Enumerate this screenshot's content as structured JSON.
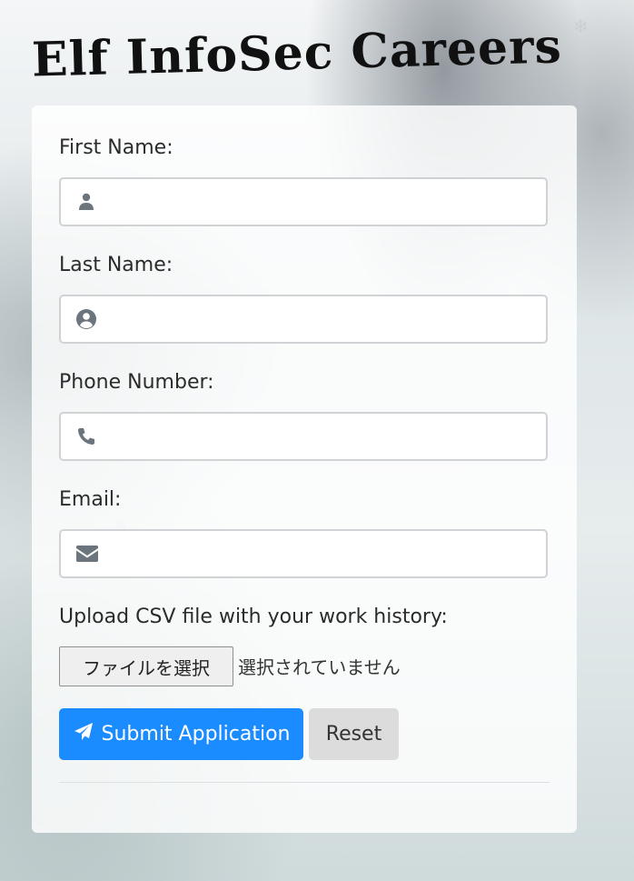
{
  "header": {
    "title": "Elf InfoSec Careers"
  },
  "form": {
    "first_name": {
      "label": "First Name:",
      "value": "",
      "icon": "user-icon"
    },
    "last_name": {
      "label": "Last Name:",
      "value": "",
      "icon": "user-circle-icon"
    },
    "phone": {
      "label": "Phone Number:",
      "value": "",
      "icon": "phone-icon"
    },
    "email": {
      "label": "Email:",
      "value": "",
      "icon": "envelope-icon"
    },
    "upload": {
      "label": "Upload CSV file with your work history:",
      "button_label": "ファイルを選択",
      "status": "選択されていません"
    },
    "submit_label": "Submit Application",
    "reset_label": "Reset"
  },
  "decorations": {
    "snowflake": "❄"
  },
  "colors": {
    "accent": "#1a8cff",
    "icon": "#6c757d"
  }
}
